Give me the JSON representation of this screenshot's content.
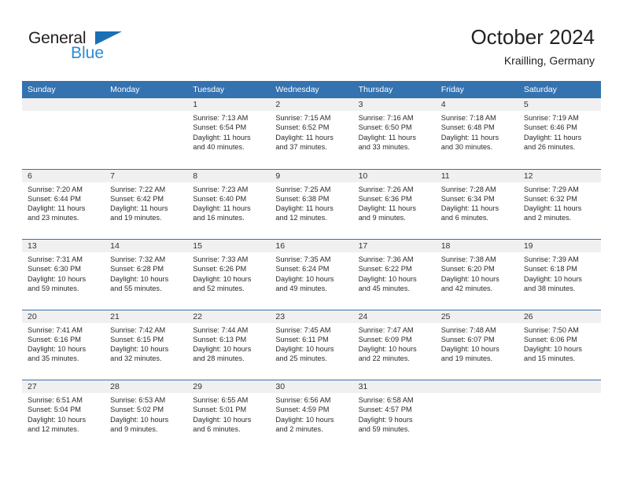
{
  "brand": {
    "word_general": "General",
    "word_blue": "Blue",
    "flag_icon": "triangle-flag-icon",
    "accent_color": "#1a6fb5",
    "blue_text_color": "#2d8bd4"
  },
  "header": {
    "title": "October 2024",
    "subtitle": "Krailling, Germany"
  },
  "calendar": {
    "header_bg_color": "#3572b0",
    "daynum_bg_color": "#f0f0f0",
    "weekdays": [
      "Sunday",
      "Monday",
      "Tuesday",
      "Wednesday",
      "Thursday",
      "Friday",
      "Saturday"
    ],
    "weeks": [
      [
        {
          "day": "",
          "sunrise": "",
          "sunset": "",
          "daylight_line1": "",
          "daylight_line2": ""
        },
        {
          "day": "",
          "sunrise": "",
          "sunset": "",
          "daylight_line1": "",
          "daylight_line2": ""
        },
        {
          "day": "1",
          "sunrise": "Sunrise: 7:13 AM",
          "sunset": "Sunset: 6:54 PM",
          "daylight_line1": "Daylight: 11 hours",
          "daylight_line2": "and 40 minutes."
        },
        {
          "day": "2",
          "sunrise": "Sunrise: 7:15 AM",
          "sunset": "Sunset: 6:52 PM",
          "daylight_line1": "Daylight: 11 hours",
          "daylight_line2": "and 37 minutes."
        },
        {
          "day": "3",
          "sunrise": "Sunrise: 7:16 AM",
          "sunset": "Sunset: 6:50 PM",
          "daylight_line1": "Daylight: 11 hours",
          "daylight_line2": "and 33 minutes."
        },
        {
          "day": "4",
          "sunrise": "Sunrise: 7:18 AM",
          "sunset": "Sunset: 6:48 PM",
          "daylight_line1": "Daylight: 11 hours",
          "daylight_line2": "and 30 minutes."
        },
        {
          "day": "5",
          "sunrise": "Sunrise: 7:19 AM",
          "sunset": "Sunset: 6:46 PM",
          "daylight_line1": "Daylight: 11 hours",
          "daylight_line2": "and 26 minutes."
        }
      ],
      [
        {
          "day": "6",
          "sunrise": "Sunrise: 7:20 AM",
          "sunset": "Sunset: 6:44 PM",
          "daylight_line1": "Daylight: 11 hours",
          "daylight_line2": "and 23 minutes."
        },
        {
          "day": "7",
          "sunrise": "Sunrise: 7:22 AM",
          "sunset": "Sunset: 6:42 PM",
          "daylight_line1": "Daylight: 11 hours",
          "daylight_line2": "and 19 minutes."
        },
        {
          "day": "8",
          "sunrise": "Sunrise: 7:23 AM",
          "sunset": "Sunset: 6:40 PM",
          "daylight_line1": "Daylight: 11 hours",
          "daylight_line2": "and 16 minutes."
        },
        {
          "day": "9",
          "sunrise": "Sunrise: 7:25 AM",
          "sunset": "Sunset: 6:38 PM",
          "daylight_line1": "Daylight: 11 hours",
          "daylight_line2": "and 12 minutes."
        },
        {
          "day": "10",
          "sunrise": "Sunrise: 7:26 AM",
          "sunset": "Sunset: 6:36 PM",
          "daylight_line1": "Daylight: 11 hours",
          "daylight_line2": "and 9 minutes."
        },
        {
          "day": "11",
          "sunrise": "Sunrise: 7:28 AM",
          "sunset": "Sunset: 6:34 PM",
          "daylight_line1": "Daylight: 11 hours",
          "daylight_line2": "and 6 minutes."
        },
        {
          "day": "12",
          "sunrise": "Sunrise: 7:29 AM",
          "sunset": "Sunset: 6:32 PM",
          "daylight_line1": "Daylight: 11 hours",
          "daylight_line2": "and 2 minutes."
        }
      ],
      [
        {
          "day": "13",
          "sunrise": "Sunrise: 7:31 AM",
          "sunset": "Sunset: 6:30 PM",
          "daylight_line1": "Daylight: 10 hours",
          "daylight_line2": "and 59 minutes."
        },
        {
          "day": "14",
          "sunrise": "Sunrise: 7:32 AM",
          "sunset": "Sunset: 6:28 PM",
          "daylight_line1": "Daylight: 10 hours",
          "daylight_line2": "and 55 minutes."
        },
        {
          "day": "15",
          "sunrise": "Sunrise: 7:33 AM",
          "sunset": "Sunset: 6:26 PM",
          "daylight_line1": "Daylight: 10 hours",
          "daylight_line2": "and 52 minutes."
        },
        {
          "day": "16",
          "sunrise": "Sunrise: 7:35 AM",
          "sunset": "Sunset: 6:24 PM",
          "daylight_line1": "Daylight: 10 hours",
          "daylight_line2": "and 49 minutes."
        },
        {
          "day": "17",
          "sunrise": "Sunrise: 7:36 AM",
          "sunset": "Sunset: 6:22 PM",
          "daylight_line1": "Daylight: 10 hours",
          "daylight_line2": "and 45 minutes."
        },
        {
          "day": "18",
          "sunrise": "Sunrise: 7:38 AM",
          "sunset": "Sunset: 6:20 PM",
          "daylight_line1": "Daylight: 10 hours",
          "daylight_line2": "and 42 minutes."
        },
        {
          "day": "19",
          "sunrise": "Sunrise: 7:39 AM",
          "sunset": "Sunset: 6:18 PM",
          "daylight_line1": "Daylight: 10 hours",
          "daylight_line2": "and 38 minutes."
        }
      ],
      [
        {
          "day": "20",
          "sunrise": "Sunrise: 7:41 AM",
          "sunset": "Sunset: 6:16 PM",
          "daylight_line1": "Daylight: 10 hours",
          "daylight_line2": "and 35 minutes."
        },
        {
          "day": "21",
          "sunrise": "Sunrise: 7:42 AM",
          "sunset": "Sunset: 6:15 PM",
          "daylight_line1": "Daylight: 10 hours",
          "daylight_line2": "and 32 minutes."
        },
        {
          "day": "22",
          "sunrise": "Sunrise: 7:44 AM",
          "sunset": "Sunset: 6:13 PM",
          "daylight_line1": "Daylight: 10 hours",
          "daylight_line2": "and 28 minutes."
        },
        {
          "day": "23",
          "sunrise": "Sunrise: 7:45 AM",
          "sunset": "Sunset: 6:11 PM",
          "daylight_line1": "Daylight: 10 hours",
          "daylight_line2": "and 25 minutes."
        },
        {
          "day": "24",
          "sunrise": "Sunrise: 7:47 AM",
          "sunset": "Sunset: 6:09 PM",
          "daylight_line1": "Daylight: 10 hours",
          "daylight_line2": "and 22 minutes."
        },
        {
          "day": "25",
          "sunrise": "Sunrise: 7:48 AM",
          "sunset": "Sunset: 6:07 PM",
          "daylight_line1": "Daylight: 10 hours",
          "daylight_line2": "and 19 minutes."
        },
        {
          "day": "26",
          "sunrise": "Sunrise: 7:50 AM",
          "sunset": "Sunset: 6:06 PM",
          "daylight_line1": "Daylight: 10 hours",
          "daylight_line2": "and 15 minutes."
        }
      ],
      [
        {
          "day": "27",
          "sunrise": "Sunrise: 6:51 AM",
          "sunset": "Sunset: 5:04 PM",
          "daylight_line1": "Daylight: 10 hours",
          "daylight_line2": "and 12 minutes."
        },
        {
          "day": "28",
          "sunrise": "Sunrise: 6:53 AM",
          "sunset": "Sunset: 5:02 PM",
          "daylight_line1": "Daylight: 10 hours",
          "daylight_line2": "and 9 minutes."
        },
        {
          "day": "29",
          "sunrise": "Sunrise: 6:55 AM",
          "sunset": "Sunset: 5:01 PM",
          "daylight_line1": "Daylight: 10 hours",
          "daylight_line2": "and 6 minutes."
        },
        {
          "day": "30",
          "sunrise": "Sunrise: 6:56 AM",
          "sunset": "Sunset: 4:59 PM",
          "daylight_line1": "Daylight: 10 hours",
          "daylight_line2": "and 2 minutes."
        },
        {
          "day": "31",
          "sunrise": "Sunrise: 6:58 AM",
          "sunset": "Sunset: 4:57 PM",
          "daylight_line1": "Daylight: 9 hours",
          "daylight_line2": "and 59 minutes."
        },
        {
          "day": "",
          "sunrise": "",
          "sunset": "",
          "daylight_line1": "",
          "daylight_line2": ""
        },
        {
          "day": "",
          "sunrise": "",
          "sunset": "",
          "daylight_line1": "",
          "daylight_line2": ""
        }
      ]
    ]
  }
}
